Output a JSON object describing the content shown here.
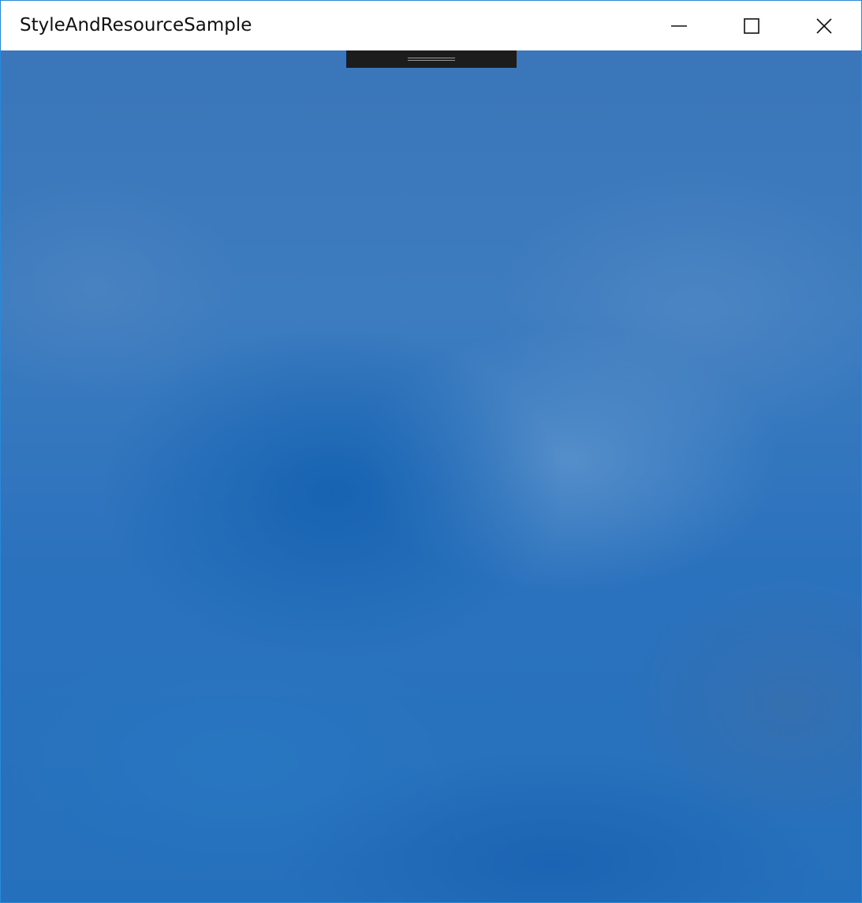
{
  "window": {
    "title": "StyleAndResourceSample",
    "border_color": "#2b8ad8",
    "titlebar_background": "#ffffff"
  },
  "caption_buttons": {
    "minimize_icon": "minimize-icon",
    "maximize_icon": "maximize-icon",
    "close_icon": "close-icon"
  },
  "content": {
    "background": "blurred blue wallpaper",
    "accent_color": "#2b6fb8",
    "drag_handle_color": "#1c1c1c"
  }
}
